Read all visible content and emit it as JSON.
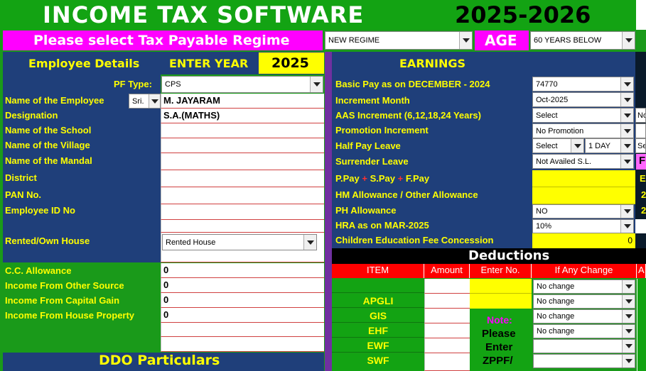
{
  "app": {
    "title": "INCOME TAX SOFTWARE",
    "year_range": "2025-2026"
  },
  "regime": {
    "label": "Please select Tax Payable Regime",
    "value": "NEW REGIME",
    "age_label": "AGE",
    "age_value": "60 YEARS BELOW"
  },
  "employee": {
    "section_title": "Employee Details",
    "enter_year_label": "ENTER YEAR",
    "year": "2025",
    "pf_type_label": "PF Type:",
    "pf_type": "CPS",
    "name_label": "Name of the Employee",
    "salutation": "Sri.",
    "name": "M. JAYARAM",
    "designation_label": "Designation",
    "designation": "S.A.(MATHS)",
    "school_label": "Name of the School",
    "village_label": "Name of the Village",
    "mandal_label": "Name of the Mandal",
    "district_label": "District",
    "pan_label": "PAN No.",
    "emp_id_label": "Employee ID No",
    "house_label": "Rented/Own House",
    "house_value": "Rented House"
  },
  "other_income": {
    "cc_label": "C.C. Allowance",
    "cc_value": "0",
    "other_source_label": "Income From Other Source",
    "other_source_value": "0",
    "capital_gain_label": "Income From Capital Gain",
    "capital_gain_value": "0",
    "house_property_label": "Income From House Property",
    "house_property_value": "0"
  },
  "ddo": {
    "title": "DDO Particulars"
  },
  "earnings": {
    "title": "EARNINGS",
    "basic_label": "Basic Pay as on DECEMBER - 2024",
    "basic_value": "74770",
    "increment_month_label": "Increment Month",
    "increment_month": "Oct-2025",
    "aas_label": "AAS Increment (6,12,18,24 Years)",
    "aas_value": "Select",
    "aas_right": "No",
    "promotion_label": "Promotion Increment",
    "promotion_value": "No Promotion",
    "half_pay_label": "Half Pay Leave",
    "half_pay_value": "Select",
    "half_pay_days": "1 DAY",
    "half_pay_right": "Se",
    "surrender_label": "Surrender Leave",
    "surrender_value": "Not Availed S.L.",
    "ppay_p": "P.Pay",
    "ppay_plus": "+",
    "ppay_s": "S.Pay",
    "ppay_f": "F.Pay",
    "hm_label": "HM Allowance / Other Allowance",
    "ph_label": "PH Allowance",
    "ph_value": "NO",
    "hra_label": "HRA as on MAR-2025",
    "hra_value": "10%",
    "children_label": "Children Education Fee Concession",
    "children_value": "0",
    "right_e": "E",
    "right_2a": "2",
    "right_2b": "2",
    "right_pink": "F"
  },
  "deductions": {
    "title": "Deductions",
    "headers": [
      "ITEM",
      "Amount",
      "Enter No.",
      "If Any Change",
      "A"
    ],
    "items": [
      "",
      "APGLI",
      "GIS",
      "EHF",
      "EWF",
      "SWF"
    ],
    "changes": [
      "No change",
      "No change",
      "No change",
      "No change"
    ],
    "note_title": "Note:",
    "note_lines": [
      "Please",
      "Enter",
      "ZPPF/"
    ]
  },
  "colors": {
    "header_green": "#13a313",
    "panel_blue": "#1f3f7a",
    "label_yellow": "#ffff00",
    "regime_pink": "#ff00ff",
    "header_red": "#ff0000",
    "divider_purple": "#7030a0"
  }
}
